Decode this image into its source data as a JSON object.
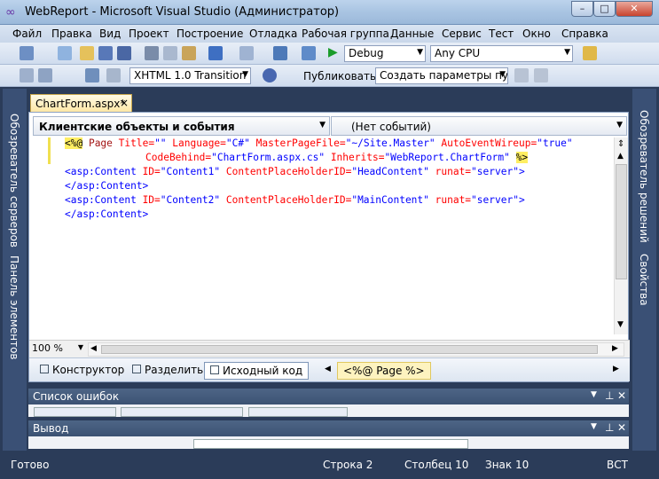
{
  "window": {
    "title": "WebReport - Microsoft Visual Studio (Администратор)",
    "min": "–",
    "max": "□",
    "close": "✕"
  },
  "menu": [
    "Файл",
    "Правка",
    "Вид",
    "Проект",
    "Построение",
    "Отладка",
    "Рабочая группа",
    "Данные",
    "Сервис",
    "Тест",
    "Окно",
    "Справка"
  ],
  "toolbar1": {
    "config": "Debug",
    "platform": "Any CPU"
  },
  "toolbar2": {
    "schema": "XHTML 1.0 Transition",
    "publish_label": "Публиковать:",
    "publish_value": "Создать параметры пуб"
  },
  "left_sidebar": [
    "Обозреватель серверов",
    "Панель элементов"
  ],
  "right_sidebar": [
    "Обозреватель решений",
    "Свойства"
  ],
  "tab": {
    "label": "ChartForm.aspx*",
    "close": "×"
  },
  "editor": {
    "objects_dropdown": "Клиентские объекты и события",
    "events_dropdown": "(Нет событий)",
    "zoom": "100 %",
    "lines": {
      "l1": {
        "open": "<%@",
        "page": " Page ",
        "title_a": "Title=",
        "title_v": "\"\"",
        "lang_a": " Language=",
        "lang_v": "\"C#\"",
        "mpf_a": " MasterPageFile=",
        "mpf_v": "\"~/Site.Master\"",
        "aew_a": " AutoEventWireup=",
        "aew_v": "\"true\""
      },
      "l2": {
        "cb_a": "CodeBehind=",
        "cb_v": "\"ChartForm.aspx.cs\"",
        "inh_a": " Inherits=",
        "inh_v": "\"WebReport.ChartForm\"",
        "close": "%>"
      },
      "l3": {
        "tag": "<asp:Content",
        "id_a": " ID=",
        "id_v": "\"Content1\"",
        "cph_a": " ContentPlaceHolderID=",
        "cph_v": "\"HeadContent\"",
        "rn_a": " runat=",
        "rn_v": "\"server\"",
        "end": ">"
      },
      "l4": "</asp:Content>",
      "l5": {
        "tag": "<asp:Content",
        "id_a": " ID=",
        "id_v": "\"Content2\"",
        "cph_a": " ContentPlaceHolderID=",
        "cph_v": "\"MainContent\"",
        "rn_a": " runat=",
        "rn_v": "\"server\"",
        "end": ">"
      },
      "l6": "</asp:Content>"
    }
  },
  "views": {
    "design": "Конструктор",
    "split": "Разделить",
    "source": "Исходный код",
    "tag_nav": "<%@ Page %>"
  },
  "panels": {
    "errors": "Список ошибок",
    "output": "Вывод"
  },
  "status": {
    "ready": "Готово",
    "line": "Строка 2",
    "col": "Столбец 10",
    "char": "Знак 10",
    "mode": "ВСТ"
  }
}
